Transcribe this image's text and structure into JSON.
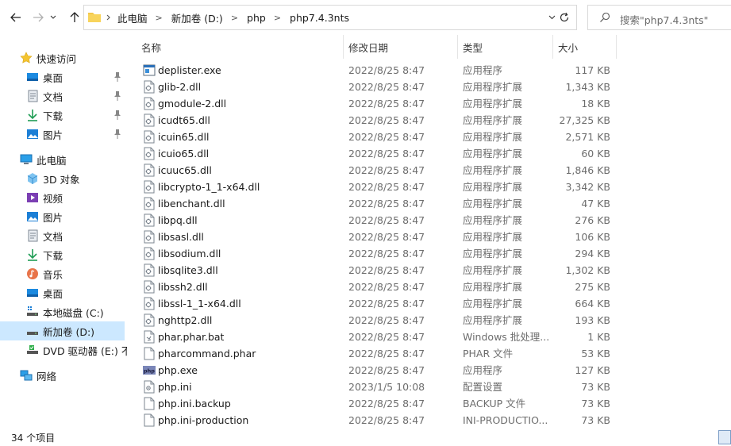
{
  "address": {
    "crumbs": [
      "此电脑",
      "新加卷 (D:)",
      "php",
      "php7.4.3nts"
    ]
  },
  "search": {
    "placeholder": "搜索\"php7.4.3nts\""
  },
  "nav": {
    "quick_access": "快速访问",
    "quick_items": [
      {
        "label": "桌面",
        "icon": "desktop-icon"
      },
      {
        "label": "文档",
        "icon": "documents-icon"
      },
      {
        "label": "下载",
        "icon": "downloads-icon"
      },
      {
        "label": "图片",
        "icon": "pictures-icon"
      }
    ],
    "this_pc": "此电脑",
    "pc_items": [
      {
        "label": "3D 对象",
        "icon": "3d-objects-icon"
      },
      {
        "label": "视频",
        "icon": "videos-icon"
      },
      {
        "label": "图片",
        "icon": "pictures-icon"
      },
      {
        "label": "文档",
        "icon": "documents-icon"
      },
      {
        "label": "下载",
        "icon": "downloads-icon"
      },
      {
        "label": "音乐",
        "icon": "music-icon"
      },
      {
        "label": "桌面",
        "icon": "desktop-icon"
      },
      {
        "label": "本地磁盘 (C:)",
        "icon": "local-disk-icon"
      },
      {
        "label": "新加卷 (D:)",
        "icon": "drive-icon",
        "selected": true
      },
      {
        "label": "DVD 驱动器 (E:) 不",
        "icon": "dvd-drive-icon"
      }
    ],
    "network": "网络"
  },
  "columns": {
    "name": "名称",
    "date": "修改日期",
    "type": "类型",
    "size": "大小"
  },
  "files": [
    {
      "name": "deplister.exe",
      "date": "2022/8/25 8:47",
      "type": "应用程序",
      "size": "117 KB",
      "icon": "exe"
    },
    {
      "name": "glib-2.dll",
      "date": "2022/8/25 8:47",
      "type": "应用程序扩展",
      "size": "1,343 KB",
      "icon": "dll"
    },
    {
      "name": "gmodule-2.dll",
      "date": "2022/8/25 8:47",
      "type": "应用程序扩展",
      "size": "18 KB",
      "icon": "dll"
    },
    {
      "name": "icudt65.dll",
      "date": "2022/8/25 8:47",
      "type": "应用程序扩展",
      "size": "27,325 KB",
      "icon": "dll"
    },
    {
      "name": "icuin65.dll",
      "date": "2022/8/25 8:47",
      "type": "应用程序扩展",
      "size": "2,571 KB",
      "icon": "dll"
    },
    {
      "name": "icuio65.dll",
      "date": "2022/8/25 8:47",
      "type": "应用程序扩展",
      "size": "60 KB",
      "icon": "dll"
    },
    {
      "name": "icuuc65.dll",
      "date": "2022/8/25 8:47",
      "type": "应用程序扩展",
      "size": "1,846 KB",
      "icon": "dll"
    },
    {
      "name": "libcrypto-1_1-x64.dll",
      "date": "2022/8/25 8:47",
      "type": "应用程序扩展",
      "size": "3,342 KB",
      "icon": "dll"
    },
    {
      "name": "libenchant.dll",
      "date": "2022/8/25 8:47",
      "type": "应用程序扩展",
      "size": "47 KB",
      "icon": "dll"
    },
    {
      "name": "libpq.dll",
      "date": "2022/8/25 8:47",
      "type": "应用程序扩展",
      "size": "276 KB",
      "icon": "dll"
    },
    {
      "name": "libsasl.dll",
      "date": "2022/8/25 8:47",
      "type": "应用程序扩展",
      "size": "106 KB",
      "icon": "dll"
    },
    {
      "name": "libsodium.dll",
      "date": "2022/8/25 8:47",
      "type": "应用程序扩展",
      "size": "294 KB",
      "icon": "dll"
    },
    {
      "name": "libsqlite3.dll",
      "date": "2022/8/25 8:47",
      "type": "应用程序扩展",
      "size": "1,302 KB",
      "icon": "dll"
    },
    {
      "name": "libssh2.dll",
      "date": "2022/8/25 8:47",
      "type": "应用程序扩展",
      "size": "275 KB",
      "icon": "dll"
    },
    {
      "name": "libssl-1_1-x64.dll",
      "date": "2022/8/25 8:47",
      "type": "应用程序扩展",
      "size": "664 KB",
      "icon": "dll"
    },
    {
      "name": "nghttp2.dll",
      "date": "2022/8/25 8:47",
      "type": "应用程序扩展",
      "size": "193 KB",
      "icon": "dll"
    },
    {
      "name": "phar.phar.bat",
      "date": "2022/8/25 8:47",
      "type": "Windows 批处理...",
      "size": "1 KB",
      "icon": "bat"
    },
    {
      "name": "pharcommand.phar",
      "date": "2022/8/25 8:47",
      "type": "PHAR 文件",
      "size": "53 KB",
      "icon": "file"
    },
    {
      "name": "php.exe",
      "date": "2022/8/25 8:47",
      "type": "应用程序",
      "size": "127 KB",
      "icon": "php-exe"
    },
    {
      "name": "php.ini",
      "date": "2023/1/5 10:08",
      "type": "配置设置",
      "size": "73 KB",
      "icon": "ini"
    },
    {
      "name": "php.ini.backup",
      "date": "2022/8/25 8:47",
      "type": "BACKUP 文件",
      "size": "73 KB",
      "icon": "file"
    },
    {
      "name": "php.ini-production",
      "date": "2022/8/25 8:47",
      "type": "INI-PRODUCTIO...",
      "size": "73 KB",
      "icon": "file"
    }
  ],
  "status": {
    "count": "34 个项目"
  }
}
